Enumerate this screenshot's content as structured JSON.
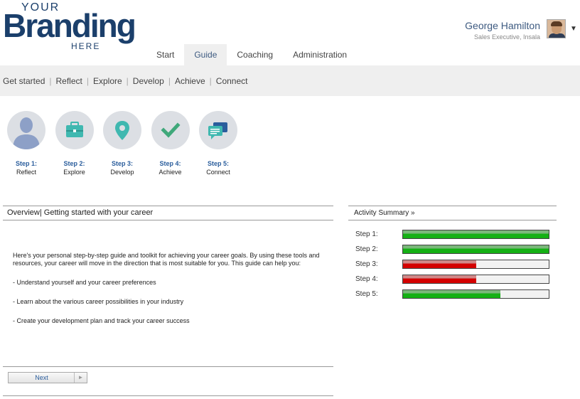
{
  "logo": {
    "line1": "YOUR",
    "line2": "Branding",
    "line3": "HERE"
  },
  "user": {
    "name": "George Hamilton",
    "role": "Sales Executive, Insala"
  },
  "main_nav": [
    {
      "label": "Start",
      "active": false
    },
    {
      "label": "Guide",
      "active": true
    },
    {
      "label": "Coaching",
      "active": false
    },
    {
      "label": "Administration",
      "active": false
    }
  ],
  "sub_nav": [
    "Get started",
    "Reflect",
    "Explore",
    "Develop",
    "Achieve",
    "Connect"
  ],
  "steps": [
    {
      "num": "Step 1:",
      "label": "Reflect",
      "icon": "person-icon"
    },
    {
      "num": "Step 2:",
      "label": "Explore",
      "icon": "briefcase-icon"
    },
    {
      "num": "Step 3:",
      "label": "Develop",
      "icon": "map-pin-icon"
    },
    {
      "num": "Step 4:",
      "label": "Achieve",
      "icon": "checkmark-icon"
    },
    {
      "num": "Step 5:",
      "label": "Connect",
      "icon": "chat-bubbles-icon"
    }
  ],
  "overview": {
    "title": "Overview",
    "subtitle": "Getting started with your career",
    "intro": "Here's your personal step-by-step guide and toolkit for achieving your career goals. By using these tools and resources, your career will move in the direction that is most suitable for you. This guide can help you:",
    "bullets": [
      "- Understand yourself and your career preferences",
      "- Learn about the various career possibilities in your industry",
      "- Create your development plan and track your career success"
    ],
    "next_label": "Next"
  },
  "activity": {
    "title": "Activity Summary »",
    "rows": [
      {
        "label": "Step 1:",
        "progress": 1.0,
        "color": "green"
      },
      {
        "label": "Step 2:",
        "progress": 1.0,
        "color": "green"
      },
      {
        "label": "Step 3:",
        "progress": 0.5,
        "color": "red"
      },
      {
        "label": "Step 4:",
        "progress": 0.5,
        "color": "red"
      },
      {
        "label": "Step 5:",
        "progress": 0.67,
        "color": "green"
      }
    ]
  },
  "colors": {
    "brand": "#1b3f6b",
    "accent": "#2a5d9c",
    "green": "#14b014",
    "red": "#d40000",
    "icon_teal": "#3fb8b0"
  }
}
